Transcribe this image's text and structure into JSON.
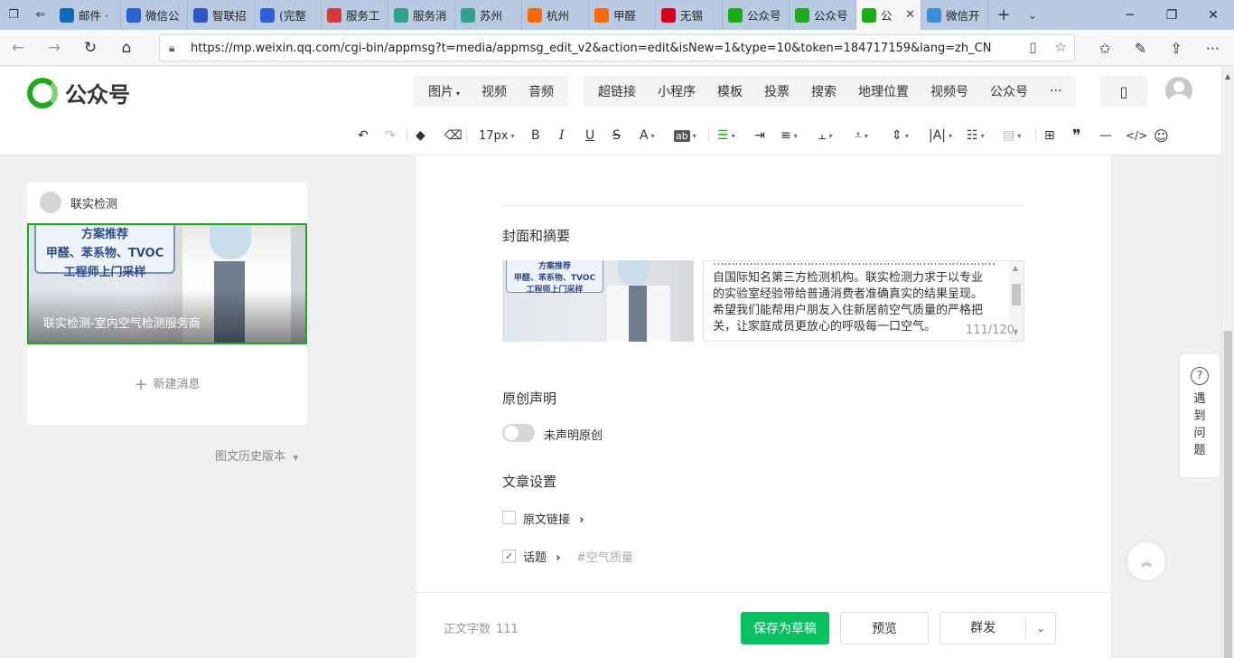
{
  "browser": {
    "tabs": [
      {
        "label": "邮件 ·",
        "icon": "outlook-icon",
        "color": "#0f6cbd"
      },
      {
        "label": "微信公",
        "icon": "baidu-paw-icon",
        "color": "#2f5fd6"
      },
      {
        "label": "智联招",
        "icon": "zhaopin-icon",
        "color": "#2b59c3"
      },
      {
        "label": "(完整",
        "icon": "baidu-paw-icon",
        "color": "#2f5fd6"
      },
      {
        "label": "服务工",
        "icon": "service-icon",
        "color": "#d63b3b"
      },
      {
        "label": "服务消",
        "icon": "doc-icon",
        "color": "#2fa38a"
      },
      {
        "label": "苏州",
        "icon": "doc-icon",
        "color": "#2fa38a"
      },
      {
        "label": "杭州",
        "icon": "taobao-icon",
        "color": "#ff6a00"
      },
      {
        "label": "甲醛",
        "icon": "taobao-icon",
        "color": "#ff6a00"
      },
      {
        "label": "无锡",
        "icon": "t-icon",
        "color": "#d9001b"
      },
      {
        "label": "公众号",
        "icon": "wechat-mp-icon",
        "color": "#1aad19"
      },
      {
        "label": "公众号",
        "icon": "wechat-mp-icon",
        "color": "#1aad19"
      },
      {
        "label": "公",
        "icon": "wechat-mp-icon",
        "color": "#1aad19",
        "active": true
      },
      {
        "label": "微信开",
        "icon": "dots-icon",
        "color": "#3b8fd9"
      }
    ],
    "url": "https://mp.weixin.qq.com/cgi-bin/appmsg?t=media/appmsg_edit_v2&action=edit&isNew=1&type=10&token=184717159&lang=zh_CN"
  },
  "header": {
    "logo_text": "公众号",
    "media_buttons": [
      "图片",
      "视频",
      "音频"
    ],
    "insert_buttons": [
      "超链接",
      "小程序",
      "模板",
      "投票",
      "搜索",
      "地理位置",
      "视频号",
      "公众号",
      "···"
    ]
  },
  "toolbar": {
    "font_size": "17px",
    "bold": "B",
    "italic": "I",
    "underline": "U",
    "strike": "S",
    "font_color": "A",
    "highlight": "ab"
  },
  "left": {
    "account_name": "联实检测",
    "cover_board_lines": [
      "方案推荐",
      "甲醛、苯系物、TVOC",
      "工程师上门采样"
    ],
    "cover_title": "联实检测-室内空气检测服务商",
    "new_message": "新建消息",
    "history": "图文历史版本"
  },
  "main": {
    "cover_section_title": "封面和摘要",
    "thumb_board_lines": [
      "方案推荐",
      "甲醛、苯系物、TVOC",
      "工程师上门采样"
    ],
    "summary_lines": [
      "……………………………………………………………………",
      "自国际知名第三方检测机构。联实检测力求于以专业",
      "的实验室经验带给普通消费者准确真实的结果呈现。",
      "希望我们能帮用户朋友入住新居前空气质量的严格把",
      "关，让家庭成员更放心的呼吸每一口空气。"
    ],
    "summary_counter": "111/120",
    "original_title": "原创声明",
    "original_toggle_label": "未声明原创",
    "settings_title": "文章设置",
    "source_link_label": "原文链接",
    "topic_label": "话题",
    "topic_placeholder": "#空气质量",
    "word_count_label": "正文字数",
    "word_count_value": "111",
    "save_draft": "保存为草稿",
    "preview": "预览",
    "mass_send": "群发"
  },
  "help": {
    "chars": [
      "遇",
      "到",
      "问",
      "题"
    ]
  }
}
